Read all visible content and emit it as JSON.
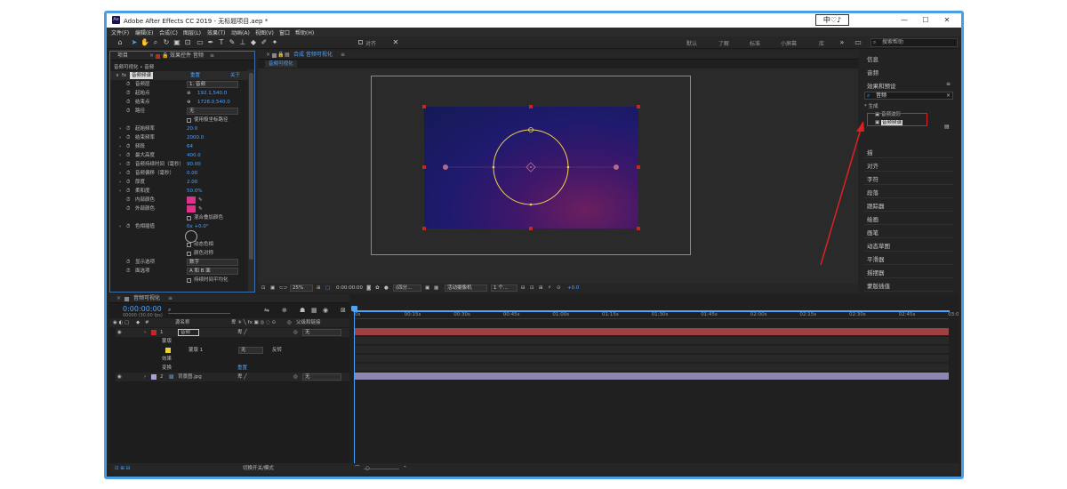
{
  "titlebar": {
    "app_icon": "Ae",
    "title": "Adobe After Effects CC 2019 - 无标题项目.aep *",
    "logo_text": "中♡♪"
  },
  "menubar": {
    "items": [
      "文件(F)",
      "编辑(E)",
      "合成(C)",
      "图层(L)",
      "效果(T)",
      "动画(A)",
      "视图(V)",
      "窗口",
      "帮助(H)"
    ]
  },
  "toolbar": {
    "align_label": "对齐",
    "workspaces": [
      "默认",
      "了解",
      "标准",
      "小屏幕",
      "库"
    ],
    "search_placeholder": "搜索帮助"
  },
  "left_panel": {
    "tabs": {
      "project": "项目",
      "effects": "效果控件 音频"
    },
    "breadcrumb": "音频可视化 • 音频",
    "fx_name": "音频频谱",
    "reset": "重置",
    "about": "关于",
    "rows": [
      {
        "label": "音频层",
        "value": "1. 音频"
      },
      {
        "label": "起始点",
        "value": "192.1,540.0"
      },
      {
        "label": "结束点",
        "value": "1728.0,540.0"
      },
      {
        "label": "路径",
        "value": "无"
      },
      {
        "label": "",
        "value": "使用极坐标路径"
      },
      {
        "label": "起始频率",
        "value": "20.0"
      },
      {
        "label": "结束频率",
        "value": "2000.0"
      },
      {
        "label": "频段",
        "value": "64"
      },
      {
        "label": "最大高度",
        "value": "400.0"
      },
      {
        "label": "音频持续时间（毫秒）",
        "value": "90.00"
      },
      {
        "label": "音频偏移（毫秒）",
        "value": "0.00"
      },
      {
        "label": "厚度",
        "value": "2.00"
      },
      {
        "label": "柔和度",
        "value": "50.0%"
      },
      {
        "label": "内部颜色",
        "value": ""
      },
      {
        "label": "外部颜色",
        "value": ""
      },
      {
        "label": "",
        "value": "混合叠加颜色"
      },
      {
        "label": "色相插值",
        "value": "0x +0.0°"
      },
      {
        "label": "",
        "value": ""
      },
      {
        "label": "",
        "value": "动态色相"
      },
      {
        "label": "",
        "value": "颜色对称"
      },
      {
        "label": "显示选项",
        "value": "数字"
      },
      {
        "label": "面选项",
        "value": "A 和 B 面"
      },
      {
        "label": "",
        "value": "持续时间平均化"
      }
    ]
  },
  "comp_panel": {
    "title": "合成 音频可视化",
    "tab": "音频可视化",
    "zoom": "25%",
    "timecode": "0:00:00:00",
    "resolution": "(四分…",
    "camera": "活动摄像机",
    "views": "1 个…",
    "exposure": "+0.0"
  },
  "right_panel": {
    "items": [
      "信息",
      "音频",
      "效果和预设"
    ],
    "search_value": "音频",
    "tree_group": "* 生成",
    "tree_items": [
      "音频波形",
      "音频频谱"
    ],
    "lower_items": [
      "描",
      "对齐",
      "字符",
      "段落",
      "跟踪器",
      "绘画",
      "画笔",
      "动态草图",
      "平滑器",
      "摇摆器",
      "蒙版插值"
    ]
  },
  "timeline": {
    "tab": "音频可视化",
    "timecode": "0:00:00:00",
    "timecode_sub": "00000 (30.00 fps)",
    "columns": {
      "layer_name": "源名称",
      "parent": "父级和链接"
    },
    "ruler": [
      "0s",
      "00:15s",
      "00:30s",
      "00:45s",
      "01:00s",
      "01:15s",
      "01:30s",
      "01:45s",
      "02:00s",
      "02:15s",
      "02:30s",
      "02:45s",
      "03:0"
    ],
    "layers": [
      {
        "num": "1",
        "name": "音频",
        "color": "#c02828",
        "parent": "无"
      },
      {
        "num": "",
        "name": "蒙版",
        "color": "",
        "parent": ""
      },
      {
        "num": "",
        "name": "蒙版 1",
        "color": "#e6d23a",
        "parent": "无",
        "mode": "反转"
      },
      {
        "num": "",
        "name": "效果",
        "color": "",
        "parent": ""
      },
      {
        "num": "",
        "name": "变换",
        "color": "",
        "parent": "重置"
      },
      {
        "num": "2",
        "name": "背景图.jpg",
        "color": "#a9a3d9",
        "parent": "无"
      }
    ],
    "footer": "切换开关/模式"
  },
  "colors": {
    "accent": "#4aa3ff",
    "highlight_red": "#e02020",
    "track_red": "#a04040",
    "track_purple": "#8c86b0",
    "canvas_circle": "#f2d34f"
  }
}
